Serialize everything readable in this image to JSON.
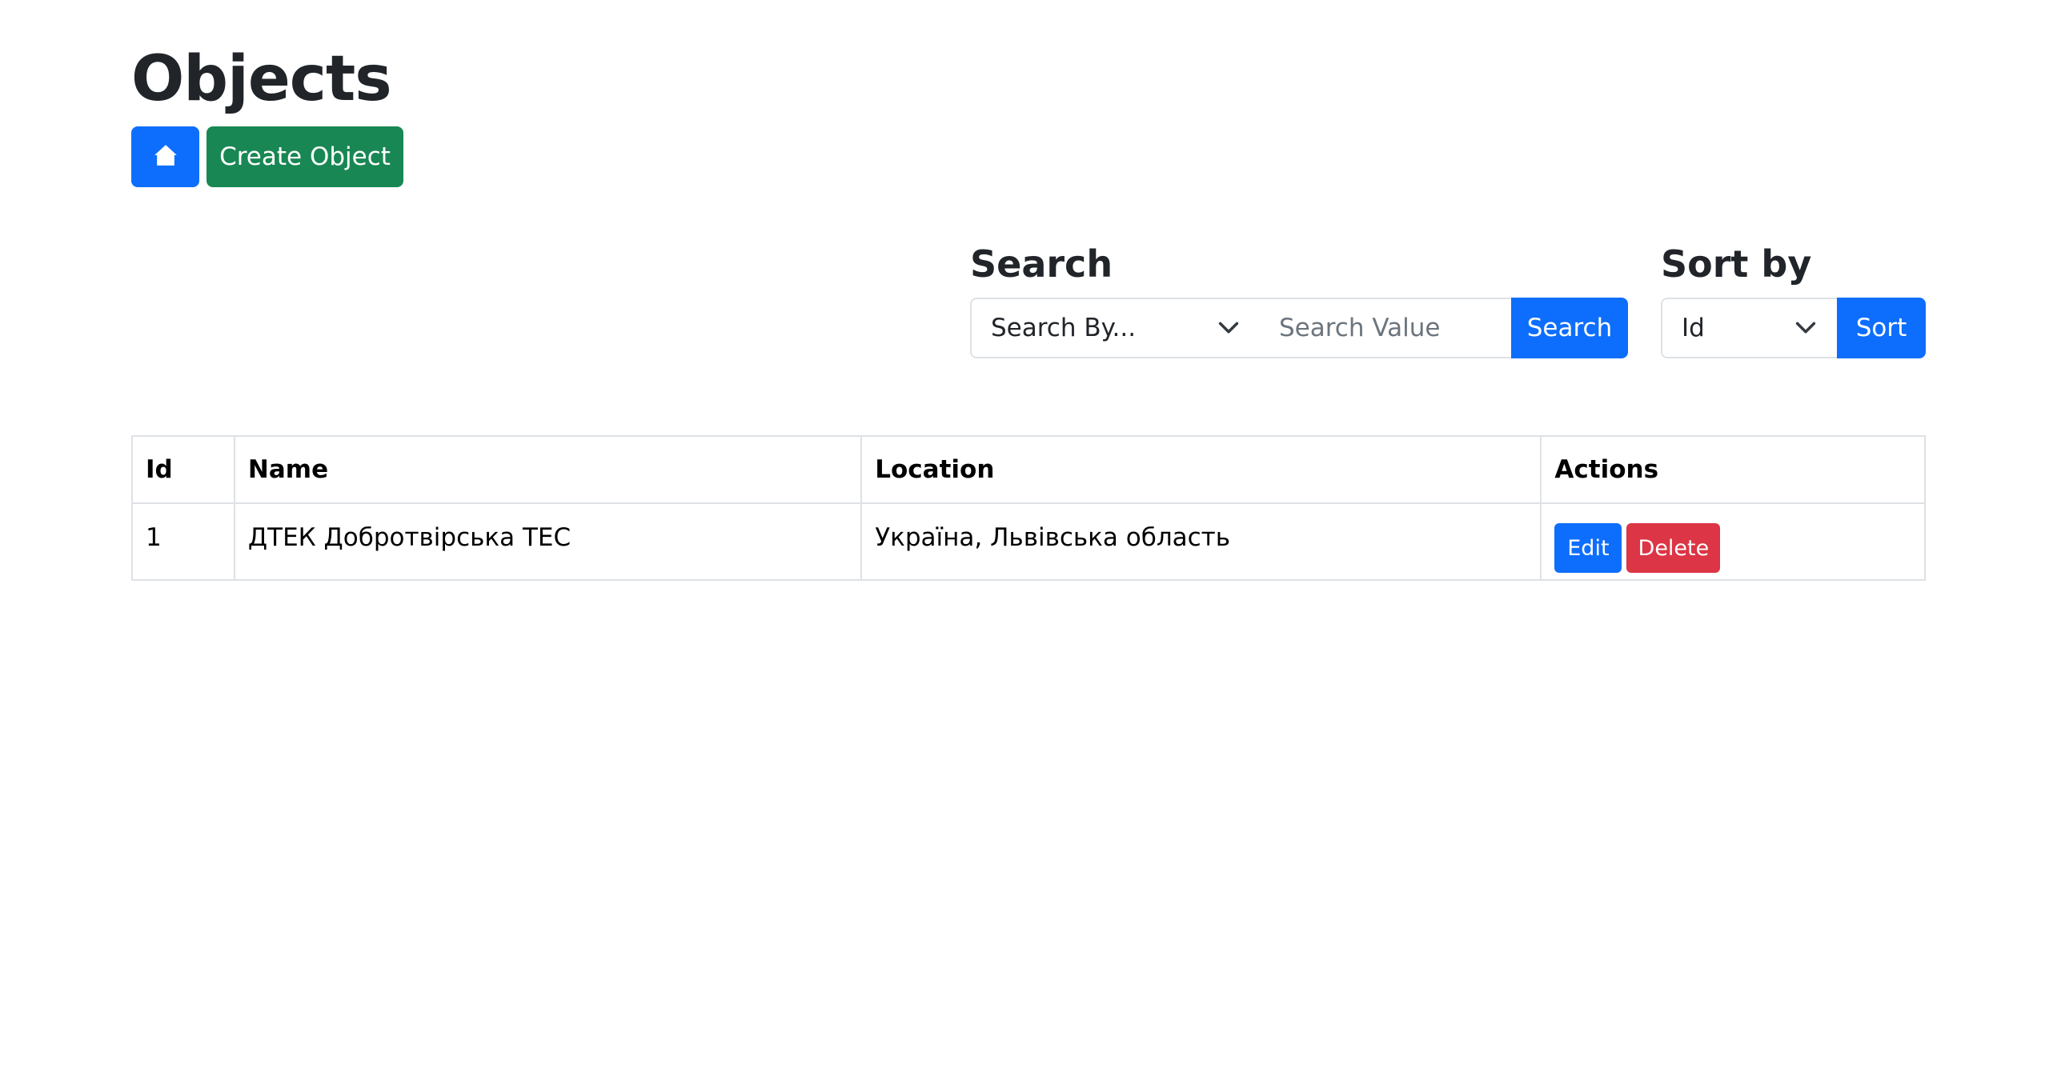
{
  "page": {
    "title": "Objects"
  },
  "toolbar": {
    "home_icon": "house-icon",
    "create_label": "Create Object"
  },
  "search": {
    "label": "Search",
    "by_value": "Search By...",
    "placeholder": "Search Value",
    "button_label": "Search"
  },
  "sort": {
    "label": "Sort by",
    "by_value": "Id",
    "button_label": "Sort"
  },
  "table": {
    "headers": {
      "id": "Id",
      "name": "Name",
      "location": "Location",
      "actions": "Actions"
    },
    "rows": [
      {
        "id": "1",
        "name": "ДТЕК Добротвірська ТЕС",
        "location": "Україна, Львівська область",
        "edit_label": "Edit",
        "delete_label": "Delete"
      }
    ]
  },
  "colors": {
    "primary": "#0d6efd",
    "success": "#198754",
    "danger": "#dc3545",
    "border": "#dee2e6"
  }
}
